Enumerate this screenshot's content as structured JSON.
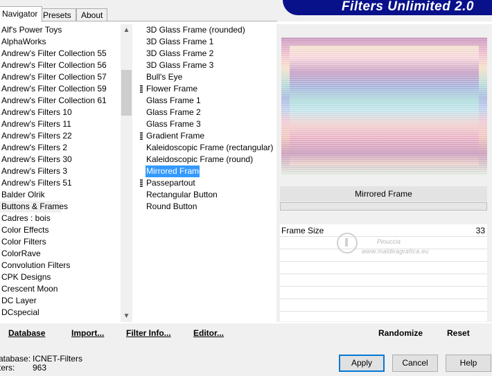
{
  "tabs": [
    {
      "label": "Navigator",
      "active": true
    },
    {
      "label": "Presets",
      "active": false
    },
    {
      "label": "About",
      "active": false
    }
  ],
  "banner_title": "Filters Unlimited 2.0",
  "categories": [
    "Alf's Power Toys",
    "AlphaWorks",
    "Andrew's Filter Collection 55",
    "Andrew's Filter Collection 56",
    "Andrew's Filter Collection 57",
    "Andrew's Filter Collection 59",
    "Andrew's Filter Collection 61",
    "Andrew's Filters 10",
    "Andrew's Filters 11",
    "Andrew's Filters 22",
    "Andrew's Filters 2",
    "Andrew's Filters 30",
    "Andrew's Filters 3",
    "Andrew's Filters 51",
    "Balder Olrik",
    "Buttons & Frames",
    "Cadres : bois",
    "Color Effects",
    "Color Filters",
    "ColorRave",
    "Convolution Filters",
    "CPK Designs",
    "Crescent Moon",
    "DC Layer",
    "DCspecial"
  ],
  "selected_category": "Buttons & Frames",
  "filters": [
    {
      "label": "3D Glass Frame (rounded)",
      "marker": false
    },
    {
      "label": "3D Glass Frame 1",
      "marker": false
    },
    {
      "label": "3D Glass Frame 2",
      "marker": false
    },
    {
      "label": "3D Glass Frame 3",
      "marker": false
    },
    {
      "label": "Bull's Eye",
      "marker": false
    },
    {
      "label": "Flower Frame",
      "marker": true
    },
    {
      "label": "Glass Frame 1",
      "marker": false
    },
    {
      "label": "Glass Frame 2",
      "marker": false
    },
    {
      "label": "Glass Frame 3",
      "marker": false
    },
    {
      "label": "Gradient Frame",
      "marker": true
    },
    {
      "label": "Kaleidoscopic Frame (rectangular)",
      "marker": false
    },
    {
      "label": "Kaleidoscopic Frame (round)",
      "marker": false
    },
    {
      "label": "Mirrored Frame",
      "marker": false
    },
    {
      "label": "Passepartout",
      "marker": true
    },
    {
      "label": "Rectangular Button",
      "marker": false
    },
    {
      "label": "Round Button",
      "marker": false
    }
  ],
  "selected_filter": "Mirrored Frame",
  "current_filter_name": "Mirrored Frame",
  "progress": 0,
  "params": [
    {
      "name": "Frame Size",
      "value": "33"
    }
  ],
  "watermark": {
    "title": "Pinuccia",
    "url": "www.maldiragrafica.eu"
  },
  "bottom_links": {
    "database": "Database",
    "import": "Import...",
    "filter_info": "Filter Info...",
    "editor": "Editor...",
    "randomize": "Randomize",
    "reset": "Reset"
  },
  "status": {
    "database_label": "atabase:",
    "database_value": "ICNET-Filters",
    "filters_label": "ters:",
    "filters_value": "963"
  },
  "buttons": {
    "apply": "Apply",
    "cancel": "Cancel",
    "help": "Help"
  },
  "colors": {
    "banner": "#08108a",
    "selection": "#3399ff",
    "progress": "#06b025"
  }
}
